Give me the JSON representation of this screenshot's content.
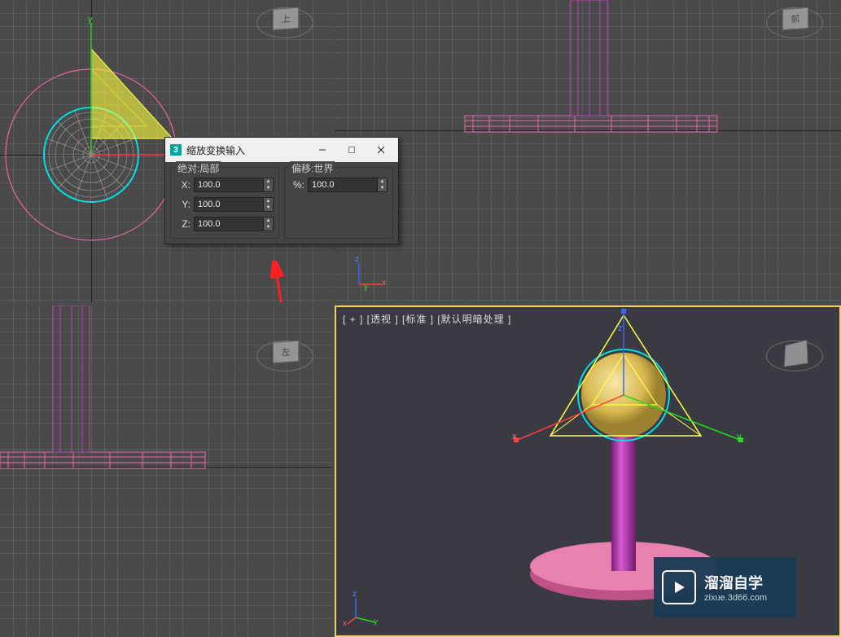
{
  "viewcube": {
    "top": "上",
    "front": "前",
    "left": "左",
    "persp": " "
  },
  "viewport_labels": {
    "persp": "[ + ]   [透视 ]   [标准 ]   [默认明暗处理 ]"
  },
  "axis_labels": {
    "x": "x",
    "y": "y",
    "z": "z"
  },
  "dialog": {
    "title": "缩放变换输入",
    "absolute_legend": "绝对:局部",
    "offset_legend": "偏移:世界",
    "x_label": "X:",
    "y_label": "Y:",
    "z_label": "Z:",
    "pct_label": "%:",
    "x": "100.0",
    "y": "100.0",
    "z": "100.0",
    "pct": "100.0"
  },
  "watermark": {
    "title": "溜溜自学",
    "url": "zixue.3d66.com"
  },
  "colors": {
    "sphere_wire": "#00e0e0",
    "sphere_fill": "#e8cf7a",
    "cylinder": "#c040c0",
    "disc": "#e864a8",
    "gizmo_yellow": "#ffff40",
    "gizmo_red": "#ff3030",
    "gizmo_green": "#20e020",
    "gizmo_blue": "#4060ff"
  }
}
